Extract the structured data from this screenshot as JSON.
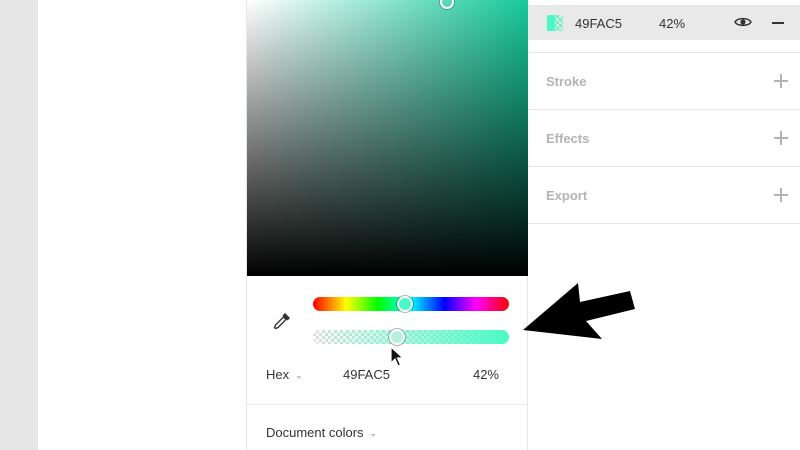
{
  "picker": {
    "color_hex": "#49FAC5",
    "hue_fraction": 0.45,
    "alpha_fraction": 0.42,
    "format_label": "Hex",
    "hex_value": "49FAC5",
    "alpha_value": "42%",
    "document_colors_label": "Document colors"
  },
  "fill": {
    "hex": "49FAC5",
    "opacity": "42%"
  },
  "sections": [
    {
      "title": "Stroke"
    },
    {
      "title": "Effects"
    },
    {
      "title": "Export"
    }
  ],
  "icons": {
    "eyedropper": "eyedropper-icon",
    "visibility": "eye-icon",
    "remove": "minus-icon",
    "add": "plus-icon",
    "chevron": "chevron-down-icon"
  }
}
